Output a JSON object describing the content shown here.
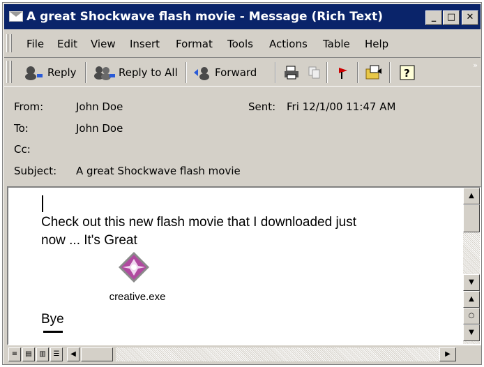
{
  "window": {
    "title": "A great Shockwave flash movie - Message (Rich Text)",
    "controls": {
      "minimize": "_",
      "maximize": "□",
      "close": "✕"
    }
  },
  "menu": [
    "File",
    "Edit",
    "View",
    "Insert",
    "Format",
    "Tools",
    "Actions",
    "Table",
    "Help"
  ],
  "toolbar": {
    "reply": "Reply",
    "reply_all": "Reply to All",
    "forward": "Forward",
    "overflow": "»"
  },
  "header": {
    "from_label": "From:",
    "from_value": "John Doe",
    "sent_label": "Sent:",
    "sent_value": "Fri 12/1/00 11:47 AM",
    "to_label": "To:",
    "to_value": "John Doe",
    "cc_label": "Cc:",
    "cc_value": "",
    "subject_label": "Subject:",
    "subject_value": "A great Shockwave flash movie"
  },
  "body": {
    "line1": "Check out this new flash movie that I downloaded just",
    "line2": "now ... It's Great",
    "attachment_name": "creative.exe",
    "closing": "Bye"
  },
  "icons": {
    "title": "envelope-icon",
    "reply": "reply-icon",
    "reply_all": "reply-all-icon",
    "forward": "forward-icon",
    "print": "print-icon",
    "copy": "copy-icon",
    "flag": "flag-icon",
    "move": "move-to-folder-icon",
    "help": "help-icon",
    "attachment": "executable-file-icon"
  },
  "colors": {
    "titlebar": "#0a246a",
    "flag": "#cc0000",
    "attachment": "#b04aa0"
  }
}
